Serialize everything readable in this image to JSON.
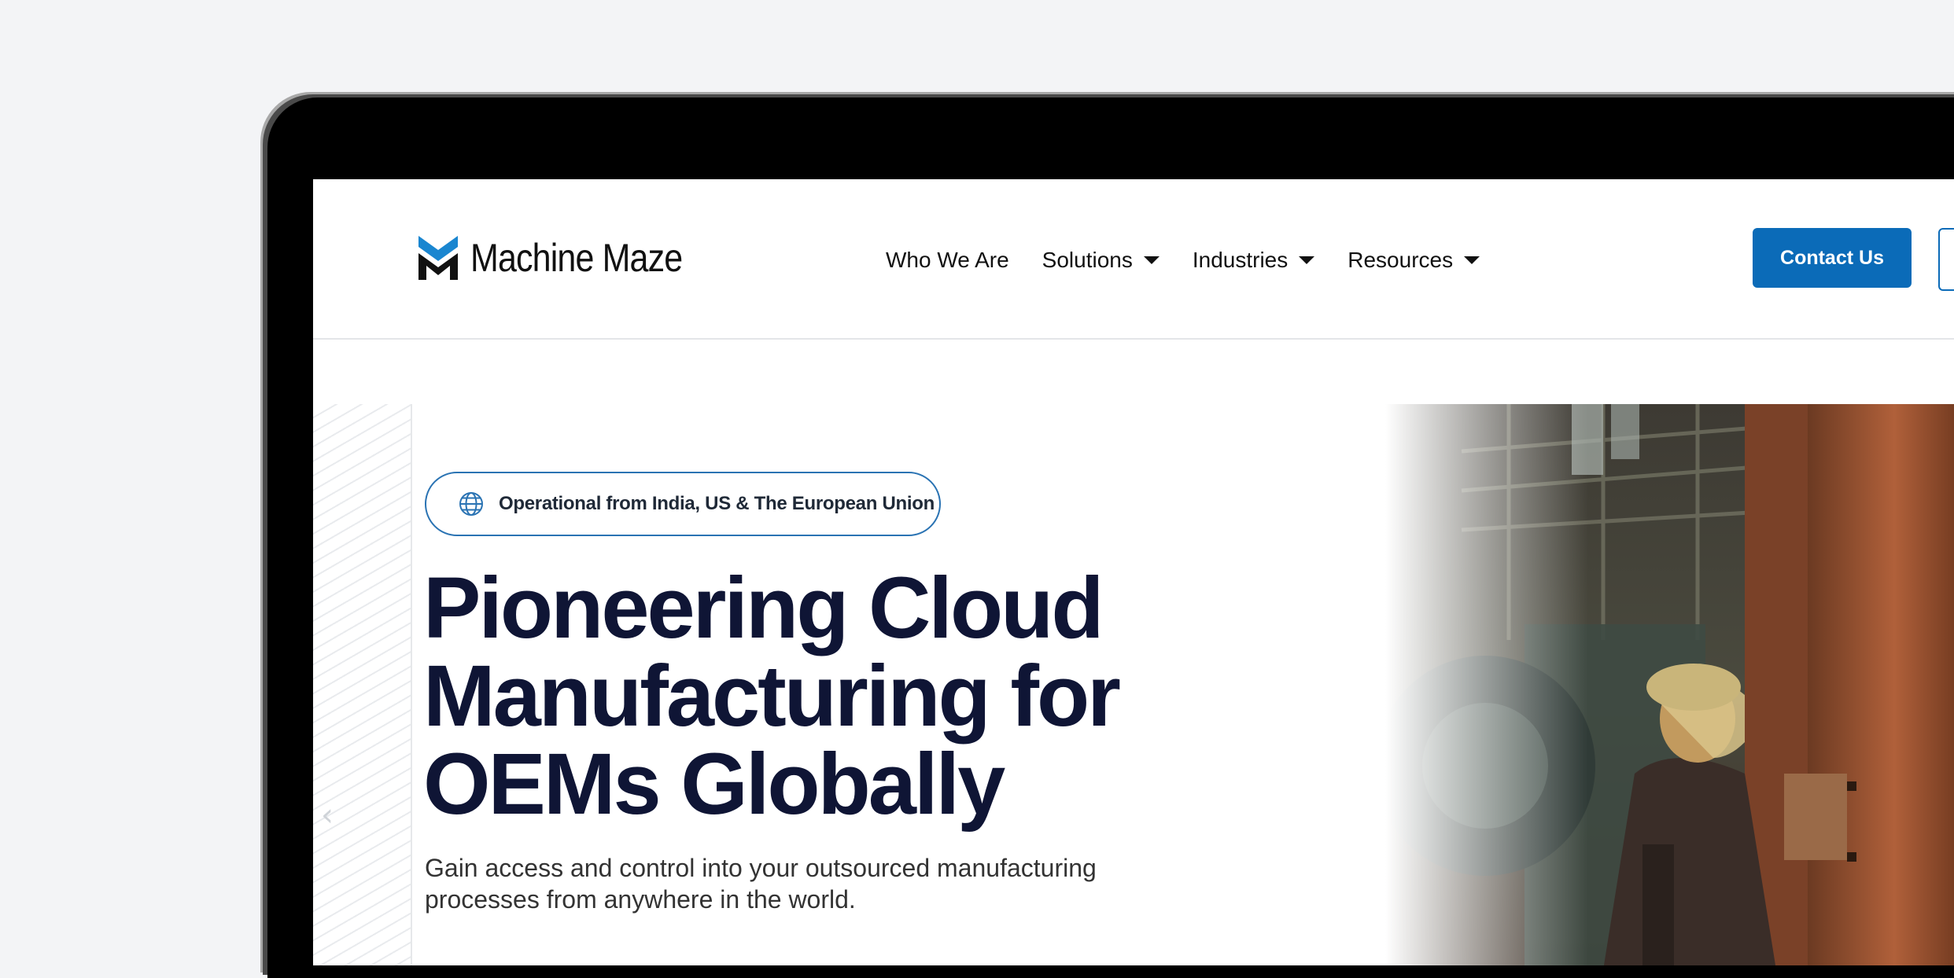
{
  "brand": {
    "name": "Machine Maze",
    "accent": "#0b6bb8",
    "dark": "#0f1535"
  },
  "nav": {
    "items": [
      {
        "label": "Who We Are",
        "dropdown": false
      },
      {
        "label": "Solutions",
        "dropdown": true
      },
      {
        "label": "Industries",
        "dropdown": true
      },
      {
        "label": "Resources",
        "dropdown": true
      }
    ]
  },
  "header": {
    "contact_label": "Contact Us"
  },
  "hero": {
    "badge": "Operational from India, US & The European Union",
    "badge_icon": "globe-icon",
    "title_lines": [
      "Pioneering Cloud",
      "Manufacturing for",
      "OEMs Globally"
    ],
    "subtitle": "Gain access and control into your outsourced manufacturing processes from anywhere in the world.",
    "image": "factory-worker-photo"
  }
}
